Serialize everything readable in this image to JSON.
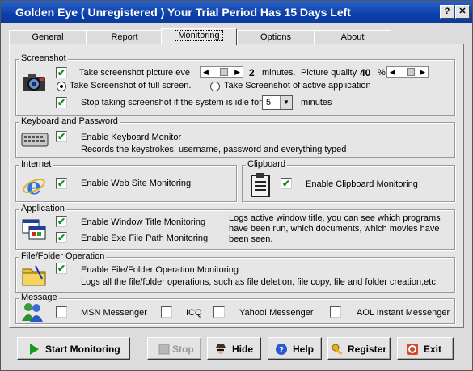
{
  "window": {
    "title": "Golden Eye ( Unregistered )  Your Trial Period Has 15 Days Left",
    "help_btn": "?",
    "close_btn": "✕"
  },
  "tabs": [
    "General",
    "Report",
    "Monitoring",
    "Options",
    "About"
  ],
  "active_tab": "Monitoring",
  "screenshot": {
    "label": "Screenshot",
    "take_every_label": "Take screenshot picture eve",
    "interval_value": "2",
    "interval_unit": "minutes.",
    "quality_label": "Picture quality",
    "quality_value": "40",
    "quality_unit": "%",
    "full_screen_label": "Take Screenshot of full screen.",
    "active_app_label": "Take Screenshot of active application",
    "idle_label": "Stop taking screenshot if the system is idle for",
    "idle_value": "5",
    "idle_unit": "minutes"
  },
  "keyboard": {
    "label": "Keyboard and Password",
    "enable_label": "Enable Keyboard Monitor",
    "description": "Records the keystrokes, username, password and everything typed"
  },
  "internet": {
    "label": "Internet",
    "enable_label": "Enable Web Site Monitoring"
  },
  "clipboard": {
    "label": "Clipboard",
    "enable_label": "Enable Clipboard Monitoring"
  },
  "application": {
    "label": "Application",
    "window_title_label": "Enable Window Title Monitoring",
    "exe_path_label": "Enable Exe File Path Monitoring",
    "description_line1": "Logs active window title, you can see which programs",
    "description_line2": "have been run, which documents, which movies have",
    "description_line3": "been seen."
  },
  "file_folder": {
    "label": "File/Folder Operation",
    "enable_label": "Enable File/Folder Operation Monitoring",
    "description": "Logs all the file/folder operations, such as file deletion, file copy, file and folder creation,etc."
  },
  "message": {
    "label": "Message",
    "msn": "MSN Messenger",
    "icq": "ICQ",
    "yahoo": "Yahoo! Messenger",
    "aol": "AOL Instant Messenger"
  },
  "checks": {
    "screenshot": true,
    "idle": true,
    "keyboard": true,
    "internet": true,
    "clipboard": true,
    "window_title": true,
    "exe_path": true,
    "file_folder": true,
    "msn": false,
    "icq": false,
    "yahoo": false,
    "aol": false
  },
  "buttons": {
    "start": "Start Monitoring",
    "stop": "Stop",
    "hide": "Hide",
    "help": "Help",
    "register": "Register",
    "exit": "Exit"
  },
  "colors": {
    "titlebar": "#0a3fa8",
    "check": "#109010"
  }
}
